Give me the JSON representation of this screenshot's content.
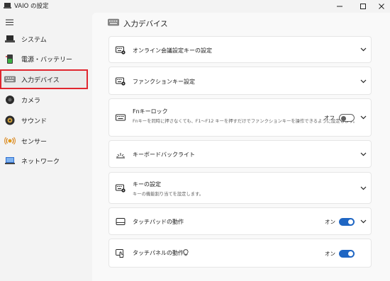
{
  "window": {
    "title": "VAIO の設定"
  },
  "titlebar_buttons": [
    "minimize-icon",
    "maximize-icon",
    "close-icon"
  ],
  "sidebar": {
    "menu_icon": "hamburger-icon",
    "items": [
      {
        "label": "システム",
        "icon": "laptop-icon",
        "selected": false
      },
      {
        "label": "電源・バッテリー",
        "icon": "battery-plug-icon",
        "selected": false
      },
      {
        "label": "入力デバイス",
        "icon": "keyboard-icon",
        "selected": true
      },
      {
        "label": "カメラ",
        "icon": "camera-icon",
        "selected": false
      },
      {
        "label": "サウンド",
        "icon": "speaker-icon",
        "selected": false
      },
      {
        "label": "センサー",
        "icon": "sensor-icon",
        "selected": false
      },
      {
        "label": "ネットワーク",
        "icon": "network-icon",
        "selected": false
      }
    ]
  },
  "header": {
    "title": "入力デバイス",
    "icon": "keyboard-icon"
  },
  "settings": [
    {
      "title": "オンライン会議設定キーの設定",
      "icon": "keyboard-gear-icon",
      "expandable": true
    },
    {
      "title": "ファンクションキー設定",
      "icon": "keyboard-gear-icon",
      "expandable": true
    },
    {
      "title": "Fnキーロック",
      "description": "Fnキーを同時に押さなくても、F1～F12 キーを押すだけでファンクションキーを操作できるように設定します。",
      "icon": "keyboard-icon",
      "toggle_label": "オフ",
      "toggle_on": false,
      "expandable": true
    },
    {
      "title": "キーボードバックライト",
      "icon": "backlight-icon",
      "expandable": true
    },
    {
      "title": "キーの設定",
      "description": "キーの機能割り当てを設定します。",
      "icon": "keyboard-gear-icon",
      "expandable": true
    },
    {
      "title": "タッチパッドの動作",
      "icon": "touchpad-icon",
      "toggle_label": "オン",
      "toggle_on": true,
      "expandable": true
    },
    {
      "title": "タッチパネルの動作",
      "title_icon": "lightbulb-icon",
      "icon": "touch-hand-icon",
      "toggle_label": "オン",
      "toggle_on": true,
      "expandable": false
    }
  ],
  "colors": {
    "accent": "#1f66c3",
    "selection_outline": "#e0262f"
  }
}
